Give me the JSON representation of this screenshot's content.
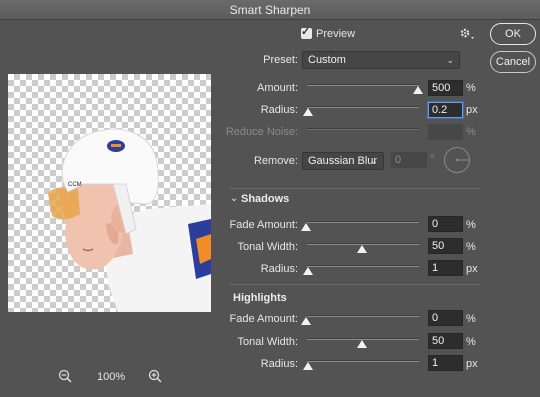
{
  "window": {
    "title": "Smart Sharpen"
  },
  "preview_toggle": {
    "label": "Preview",
    "checked": true
  },
  "buttons": {
    "ok": "OK",
    "cancel": "Cancel"
  },
  "preset": {
    "label": "Preset:",
    "value": "Custom"
  },
  "amount": {
    "label": "Amount:",
    "value": "500",
    "unit": "%",
    "slider_level": 0.98
  },
  "radius": {
    "label": "Radius:",
    "value": "0.2",
    "unit": "px",
    "slider_level": 0.0
  },
  "reduce_noise": {
    "label": "Reduce Noise:",
    "value": "",
    "unit": "%",
    "enabled": false
  },
  "remove": {
    "label": "Remove:",
    "value": "Gaussian Blur",
    "angle": "0",
    "angle_unit": "°"
  },
  "shadows": {
    "title": "Shadows",
    "fade_amount": {
      "label": "Fade Amount:",
      "value": "0",
      "unit": "%",
      "slider_level": 0.0
    },
    "tonal_width": {
      "label": "Tonal Width:",
      "value": "50",
      "unit": "%",
      "slider_level": 0.5
    },
    "radius": {
      "label": "Radius:",
      "value": "1",
      "unit": "px",
      "slider_level": 0.0
    }
  },
  "highlights": {
    "title": "Highlights",
    "fade_amount": {
      "label": "Fade Amount:",
      "value": "0",
      "unit": "%",
      "slider_level": 0.0
    },
    "tonal_width": {
      "label": "Tonal Width:",
      "value": "50",
      "unit": "%",
      "slider_level": 0.5
    },
    "radius": {
      "label": "Radius:",
      "value": "1",
      "unit": "px",
      "slider_level": 0.0
    }
  },
  "zoom": {
    "value": "100%"
  },
  "icons": {
    "settings": "gear-icon",
    "zoom_out": "zoom-out-icon",
    "zoom_in": "zoom-in-icon"
  },
  "colors": {
    "panel_bg": "#535353",
    "accent_focus": "#6b9be0"
  }
}
